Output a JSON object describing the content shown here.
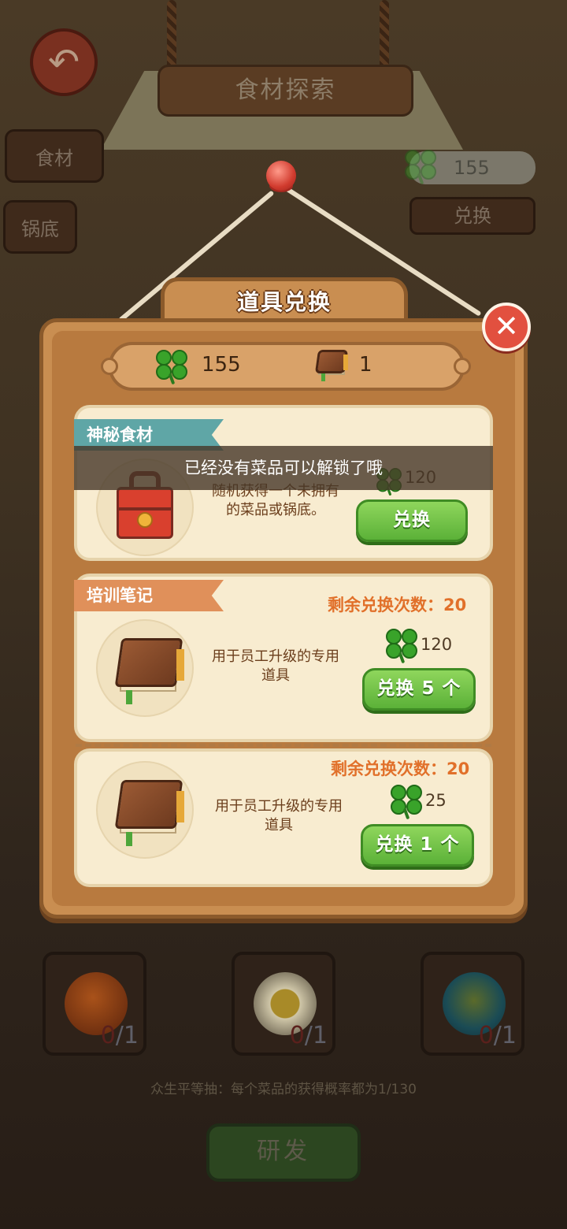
{
  "background": {
    "title": "食材探索",
    "tabs": [
      "食材",
      "锅底"
    ],
    "clover_count": "155",
    "exchange_label": "兑换",
    "slots": [
      {
        "current": "0",
        "total": "/1",
        "color": "#b8521f"
      },
      {
        "current": "0",
        "total": "/1",
        "color": "#a08a30"
      },
      {
        "current": "0",
        "total": "/1",
        "color": "#1f6f7a"
      }
    ],
    "odds_text": "众生平等抽：每个菜品的获得概率都为1/130",
    "rd_button": "研发"
  },
  "dialog": {
    "title": "道具兑换",
    "clover_balance": "155",
    "book_balance": "1",
    "toast": "已经没有菜品可以解锁了哦",
    "cards": [
      {
        "ribbon": "神秘食材",
        "ribbon_color": "#5fa6a6",
        "desc_line1": "随机获得一个未拥有",
        "desc_line2": "的菜品或锅底。",
        "price": "120",
        "button": "兑换"
      },
      {
        "ribbon": "培训笔记",
        "ribbon_color": "#e0905a",
        "remaining": "剩余兑换次数：20",
        "desc_line1": "用于员工升级的专用",
        "desc_line2": "道具",
        "price": "120",
        "button": "兑换 5 个"
      },
      {
        "remaining": "剩余兑换次数：20",
        "desc_line1": "用于员工升级的专用",
        "desc_line2": "道具",
        "price": "25",
        "button": "兑换 1 个"
      }
    ]
  },
  "icons": {
    "clover": "four-leaf-clover",
    "book": "training-notebook",
    "close": "close-x",
    "back": "back-arrow"
  }
}
